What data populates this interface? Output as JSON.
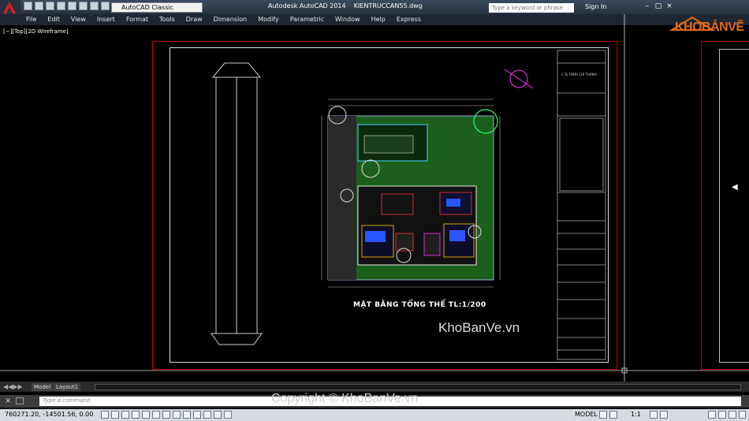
{
  "window": {
    "app_title": "Autodesk AutoCAD 2014",
    "file_name": "KIENTRUCCAN55.dwg",
    "workspace": "AutoCAD Classic",
    "search_placeholder": "Type a keyword or phrase",
    "sign_in": "Sign In"
  },
  "menu": [
    "File",
    "Edit",
    "View",
    "Insert",
    "Format",
    "Tools",
    "Draw",
    "Dimension",
    "Modify",
    "Parametric",
    "Window",
    "Help",
    "Express"
  ],
  "viewport_label": "[−][Top][2D Wireframe]",
  "drawing": {
    "plan_title": "MẶT BẰNG TỔNG THỂ  TL:1/200",
    "titleblock_company": "C.Ty TNHH CHÍ THÀNH"
  },
  "watermarks": {
    "site": "KhoBanVe.vn",
    "copyright": "Copyright © KhoBanVe.vn",
    "logo": "KHOBẢNVẼ"
  },
  "layout_tabs": [
    "Model",
    "Layout1"
  ],
  "command": {
    "placeholder": "Type a command"
  },
  "status": {
    "coords": "760271.20, -14501.56, 0.00",
    "model": "MODEL",
    "scale": "1:1"
  },
  "colors": {
    "accent": "#e36b16",
    "frame_red": "#bb0000",
    "grass": "#1d6b1d"
  }
}
